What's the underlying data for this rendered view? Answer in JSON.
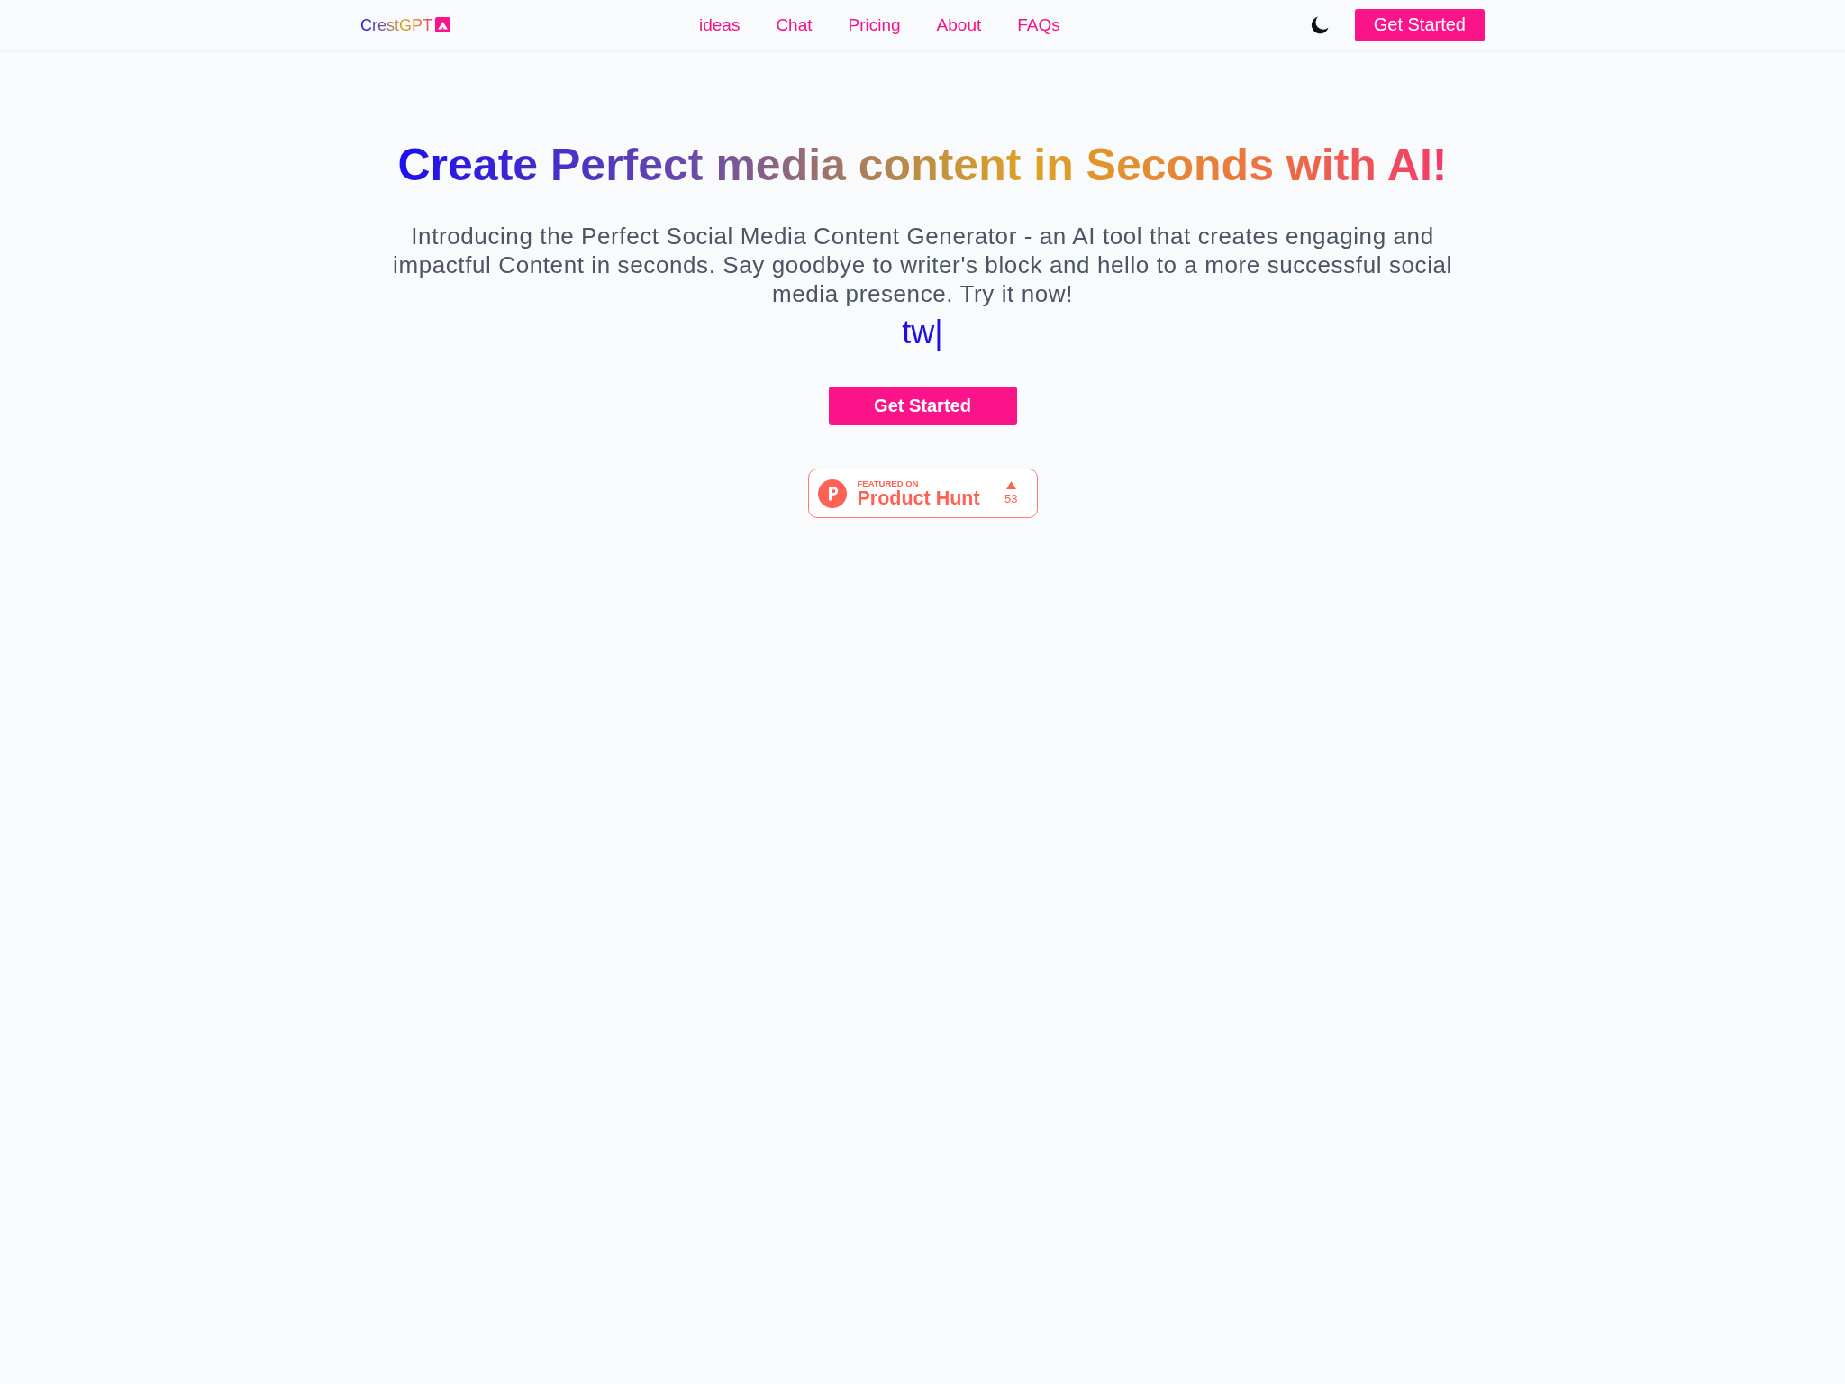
{
  "header": {
    "logo": "CrestGPT",
    "nav": [
      "ideas",
      "Chat",
      "Pricing",
      "About",
      "FAQs"
    ],
    "button": "Get Started"
  },
  "hero": {
    "title": "Create Perfect media content in Seconds with AI!",
    "description": "Introducing the Perfect Social Media Content Generator - an AI tool that creates engaging and impactful Content in seconds. Say goodbye to writer's block and hello to a more successful social media presence. Try it now!",
    "typed_text": "tw|",
    "button": "Get Started",
    "badge": {
      "kicker": "FEATURED ON",
      "name": "Product Hunt",
      "votes": "53"
    }
  }
}
